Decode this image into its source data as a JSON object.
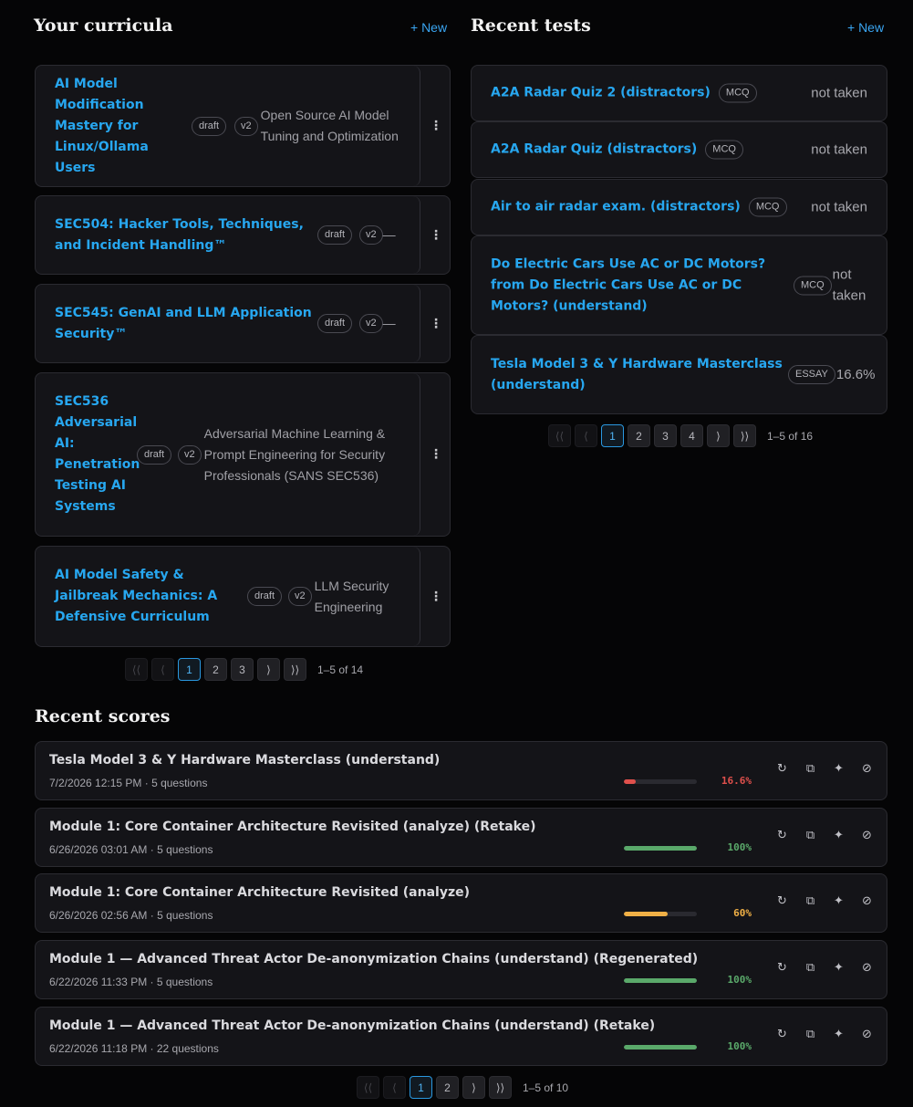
{
  "curricula": {
    "title": "Your curricula",
    "new_label": "+ New",
    "items": [
      {
        "title": "AI Model Modification Mastery for Linux/Ollama Users",
        "status": "draft",
        "version": "v2",
        "description": "Open Source AI Model Tuning and Optimization"
      },
      {
        "title": "SEC504: Hacker Tools, Techniques, and Incident Handling™",
        "status": "draft",
        "version": "v2",
        "description": "—"
      },
      {
        "title": "SEC545: GenAI and LLM Application Security™",
        "status": "draft",
        "version": "v2",
        "description": "—"
      },
      {
        "title": "SEC536 Adversarial AI: Penetration Testing AI Systems",
        "status": "draft",
        "version": "v2",
        "description": "Adversarial Machine Learning & Prompt Engineering for Security Professionals (SANS SEC536)"
      },
      {
        "title": "AI Model Safety & Jailbreak Mechanics: A Defensive Curriculum",
        "status": "draft",
        "version": "v2",
        "description": "LLM Security Engineering"
      }
    ],
    "pager": {
      "pages": [
        "1",
        "2",
        "3"
      ],
      "current": "1",
      "info": "1–5 of 14"
    }
  },
  "tests": {
    "title": "Recent tests",
    "new_label": "+ New",
    "items": [
      {
        "title": "A2A Radar Quiz 2 (distractors)",
        "type": "MCQ",
        "status": "not taken"
      },
      {
        "title": "A2A Radar Quiz (distractors)",
        "type": "MCQ",
        "status": "not taken"
      },
      {
        "title": "Air to air radar exam. (distractors)",
        "type": "MCQ",
        "status": "not taken"
      },
      {
        "title": "Do Electric Cars Use AC or DC Motors? from Do Electric Cars Use AC or DC Motors? (understand)",
        "type": "MCQ",
        "status": "not taken"
      },
      {
        "title": "Tesla Model 3 & Y Hardware Masterclass (understand)",
        "type": "ESSAY",
        "status": "16.6%"
      }
    ],
    "pager": {
      "pages": [
        "1",
        "2",
        "3",
        "4"
      ],
      "current": "1",
      "info": "1–5 of 16"
    }
  },
  "scores": {
    "title": "Recent scores",
    "items": [
      {
        "title": "Tesla Model 3 & Y Hardware Masterclass (understand)",
        "meta": "7/2/2026 12:15 PM · 5 questions",
        "percent_label": "16.6%",
        "fraction": 0.166,
        "color": "#e0504c"
      },
      {
        "title": "Module 1: Core Container Architecture Revisited (analyze) (Retake)",
        "meta": "6/26/2026 03:01 AM · 5 questions",
        "percent_label": "100%",
        "fraction": 1.0,
        "color": "#5aa96a"
      },
      {
        "title": "Module 1: Core Container Architecture Revisited (analyze)",
        "meta": "6/26/2026 02:56 AM · 5 questions",
        "percent_label": "60%",
        "fraction": 0.6,
        "color": "#f0b046"
      },
      {
        "title": "Module 1 — Advanced Threat Actor De-anonymization Chains (understand) (Regenerated)",
        "meta": "6/22/2026 11:33 PM · 5 questions",
        "percent_label": "100%",
        "fraction": 1.0,
        "color": "#5aa96a"
      },
      {
        "title": "Module 1 — Advanced Threat Actor De-anonymization Chains (understand) (Retake)",
        "meta": "6/22/2026 11:18 PM · 22 questions",
        "percent_label": "100%",
        "fraction": 1.0,
        "color": "#5aa96a"
      }
    ],
    "pager": {
      "pages": [
        "1",
        "2"
      ],
      "current": "1",
      "info": "1–5 of 10"
    }
  },
  "icons": {
    "kebab": "⋮",
    "retry": "↻",
    "copy": "⧉",
    "sparkle": "✦",
    "disable": "⊘",
    "first": "⟨⟨",
    "prev": "⟨",
    "next": "⟩",
    "last": "⟩⟩"
  },
  "colors": {
    "accent": "#27a7f0",
    "background": "#050506",
    "card": "#141418"
  }
}
